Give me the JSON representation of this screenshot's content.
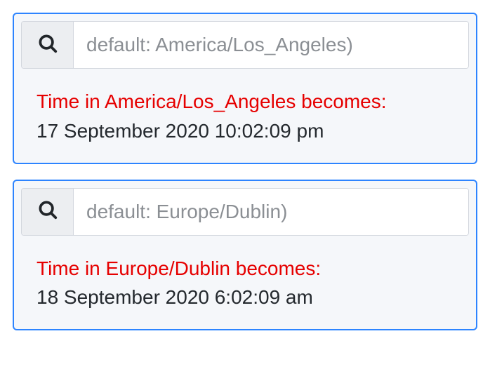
{
  "panels": [
    {
      "search_placeholder": "default: America/Los_Angeles)",
      "search_value": "",
      "result_heading": "Time in America/Los_Angeles becomes:",
      "result_value": "17 September 2020 10:02:09 pm"
    },
    {
      "search_placeholder": "default: Europe/Dublin)",
      "search_value": "",
      "result_heading": "Time in Europe/Dublin becomes:",
      "result_value": "18 September 2020 6:02:09 am"
    }
  ],
  "colors": {
    "focus_border": "#2d84ff",
    "heading_red": "#e60000",
    "panel_bg": "#f5f7fa"
  }
}
